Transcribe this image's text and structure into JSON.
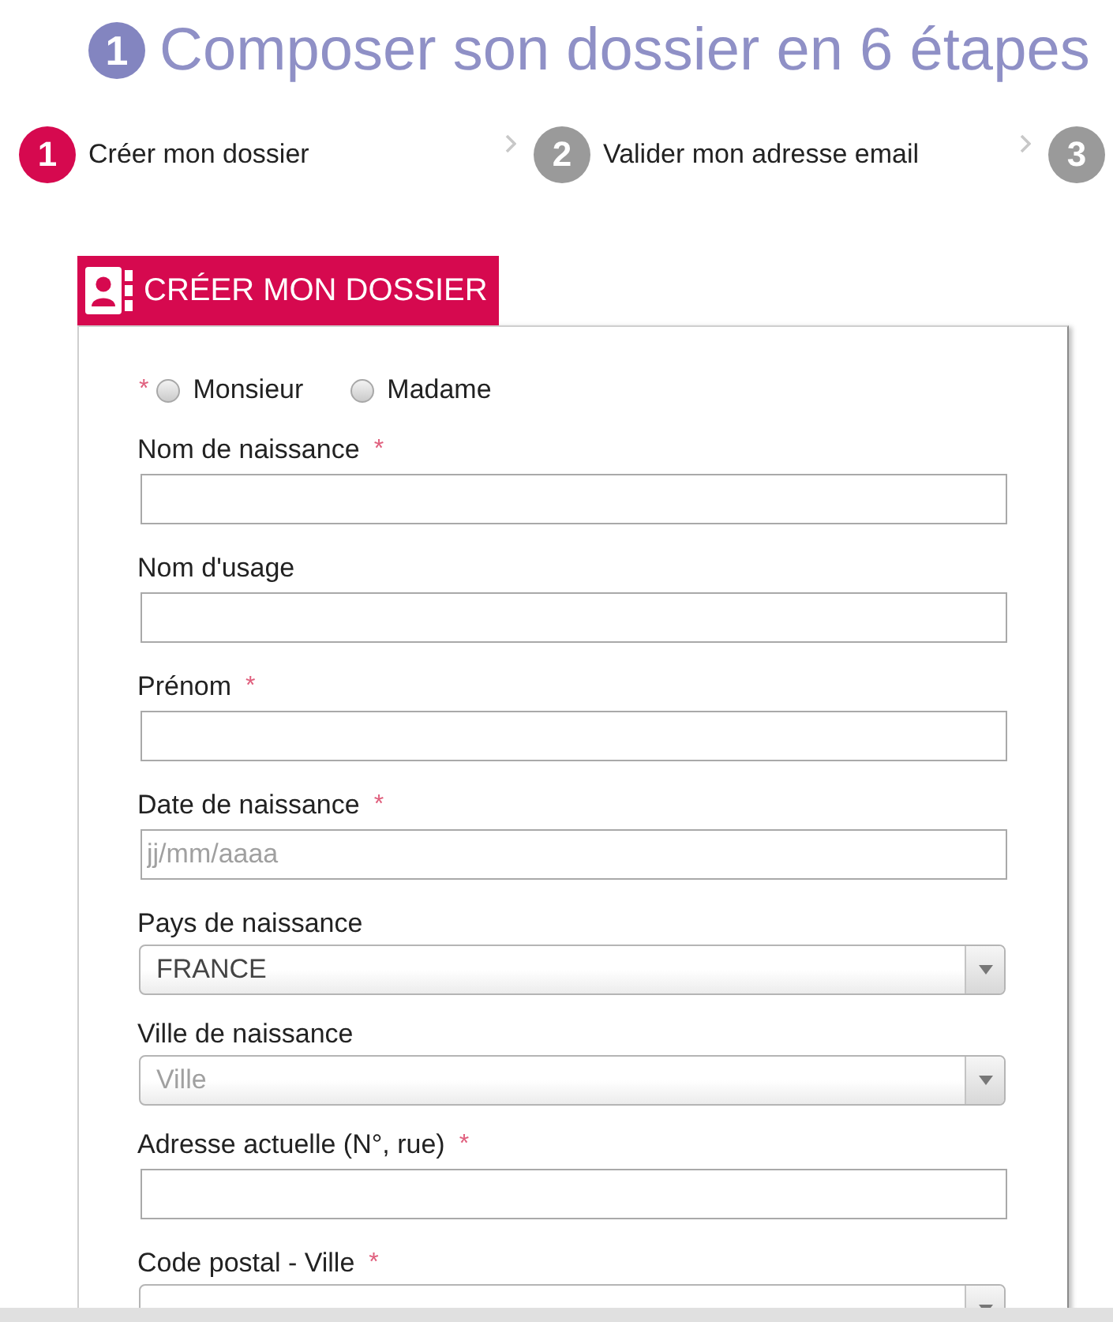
{
  "title": {
    "number": "1",
    "text": "Composer son dossier en 6 étapes"
  },
  "steps": [
    {
      "number": "1",
      "label": "Créer mon dossier",
      "selected": true
    },
    {
      "number": "2",
      "label": "Valider mon adresse email",
      "selected": false
    },
    {
      "number": "3",
      "selected": false
    }
  ],
  "section": {
    "title": "CRÉER MON DOSSIER"
  },
  "gender": {
    "required_mark": "*",
    "options": [
      {
        "label": "Monsieur",
        "selected": false
      },
      {
        "label": "Madame",
        "selected": false
      }
    ]
  },
  "fields": [
    {
      "kind": "text",
      "label": "Nom de naissance",
      "required_mark": "*"
    },
    {
      "kind": "text",
      "label": "Nom d'usage"
    },
    {
      "kind": "text",
      "label": "Prénom",
      "required_mark": "*"
    },
    {
      "kind": "text",
      "label": "Date de naissance",
      "required_mark": "*",
      "placeholder": "jj/mm/aaaa"
    },
    {
      "kind": "select",
      "label": "Pays de naissance",
      "value": "FRANCE"
    },
    {
      "kind": "select",
      "label": "Ville de naissance",
      "placeholder": "Ville"
    },
    {
      "kind": "text",
      "label": "Adresse actuelle (N°, rue)",
      "required_mark": "*"
    },
    {
      "kind": "select",
      "label": "Code postal - Ville",
      "required_mark": "*"
    }
  ]
}
